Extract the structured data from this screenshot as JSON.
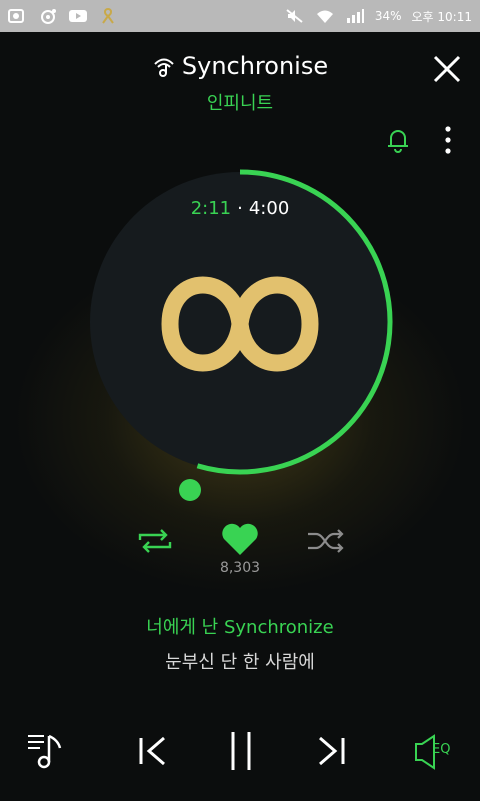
{
  "status_bar": {
    "battery": "34%",
    "time": "오후 10:11",
    "icons": [
      "gallery-icon",
      "camera-icon",
      "youtube-icon",
      "ribbon-icon",
      "mute-icon",
      "wifi-icon",
      "signal-icon"
    ]
  },
  "header": {
    "title": "Synchronise",
    "artist": "인피니트",
    "icons": [
      "cast-note-icon",
      "close-icon",
      "bell-icon",
      "more-icon"
    ]
  },
  "player": {
    "current_time": "2:11",
    "separator": "·",
    "total_time": "4:00",
    "progress": 0.5458,
    "like_count": "8,303",
    "accent_color": "#39d353",
    "logo_color": "#e2c16e"
  },
  "lyrics": {
    "current": "너에게 난 Synchronize",
    "next": "눈부신 단 한 사람에"
  },
  "controls": {
    "eq_label": "EQ",
    "icons": [
      "repeat-icon",
      "heart-icon",
      "shuffle-icon",
      "playlist-icon",
      "previous-icon",
      "pause-icon",
      "next-icon",
      "eq-icon"
    ]
  }
}
